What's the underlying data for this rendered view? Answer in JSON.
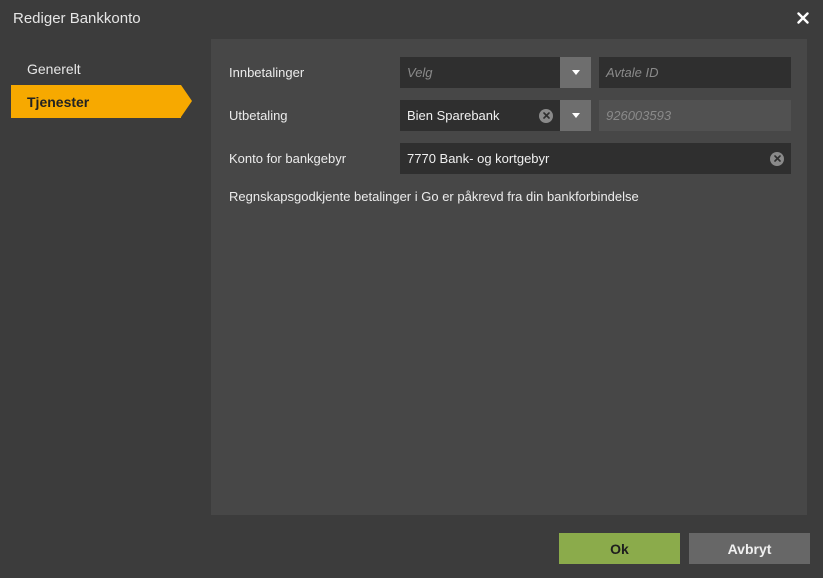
{
  "dialog": {
    "title": "Rediger Bankkonto"
  },
  "sidebar": {
    "items": [
      {
        "label": "Generelt",
        "active": false
      },
      {
        "label": "Tjenester",
        "active": true
      }
    ]
  },
  "form": {
    "innbetalinger": {
      "label": "Innbetalinger",
      "select_placeholder": "Velg",
      "agreement_placeholder": "Avtale ID"
    },
    "utbetaling": {
      "label": "Utbetaling",
      "select_value": "Bien Sparebank",
      "agreement_value": "926003593"
    },
    "bankgebyr": {
      "label": "Konto for bankgebyr",
      "value": "7770 Bank- og kortgebyr"
    },
    "info": "Regnskapsgodkjente betalinger i Go er påkrevd fra din bankforbindelse"
  },
  "buttons": {
    "ok": "Ok",
    "cancel": "Avbryt"
  },
  "colors": {
    "accent": "#f7a900",
    "ok_button": "#8bab4b",
    "background": "#3c3c3c",
    "panel": "#474747"
  }
}
